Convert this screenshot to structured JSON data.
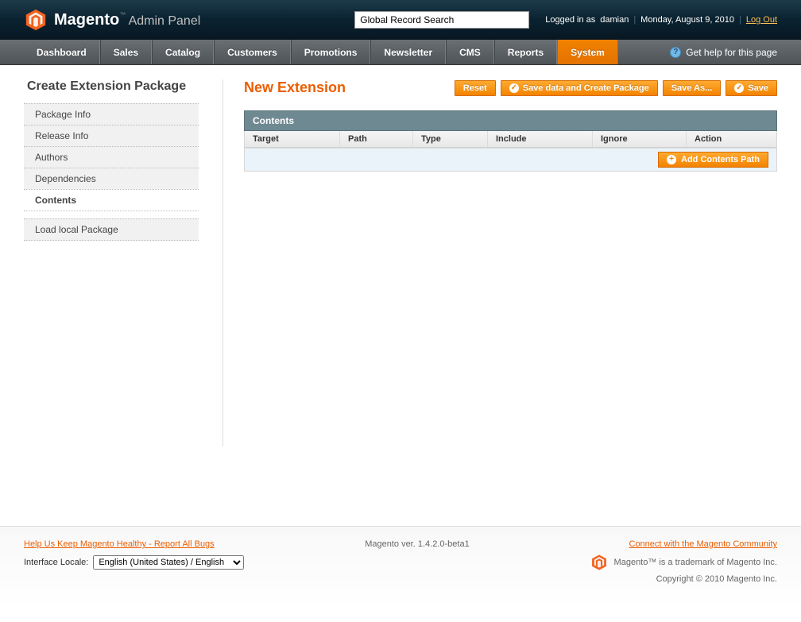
{
  "header": {
    "brand_main": "Magento",
    "brand_sub": "Admin Panel",
    "search_placeholder": "Global Record Search",
    "logged_in_prefix": "Logged in as",
    "username": "damian",
    "date": "Monday, August 9, 2010",
    "logout": "Log Out"
  },
  "nav": {
    "items": [
      "Dashboard",
      "Sales",
      "Catalog",
      "Customers",
      "Promotions",
      "Newsletter",
      "CMS",
      "Reports",
      "System"
    ],
    "active": "System",
    "help": "Get help for this page"
  },
  "sidebar": {
    "title": "Create Extension Package",
    "group1": [
      "Package Info",
      "Release Info",
      "Authors",
      "Dependencies",
      "Contents"
    ],
    "active": "Contents",
    "group2": [
      "Load local Package"
    ]
  },
  "page": {
    "title": "New Extension",
    "buttons": {
      "reset": "Reset",
      "save_create": "Save data and Create Package",
      "save_as": "Save As...",
      "save": "Save"
    }
  },
  "panel": {
    "title": "Contents",
    "columns": {
      "target": "Target",
      "path": "Path",
      "type": "Type",
      "include": "Include",
      "ignore": "Ignore",
      "action": "Action"
    },
    "add_button": "Add Contents Path"
  },
  "footer": {
    "report_bugs": "Help Us Keep Magento Healthy - Report All Bugs",
    "locale_label": "Interface Locale:",
    "locale_value": "English (United States) / English",
    "version": "Magento ver. 1.4.2.0-beta1",
    "community": "Connect with the Magento Community",
    "trademark": "Magento™ is a trademark of Magento Inc.",
    "copyright": "Copyright © 2010 Magento Inc."
  }
}
